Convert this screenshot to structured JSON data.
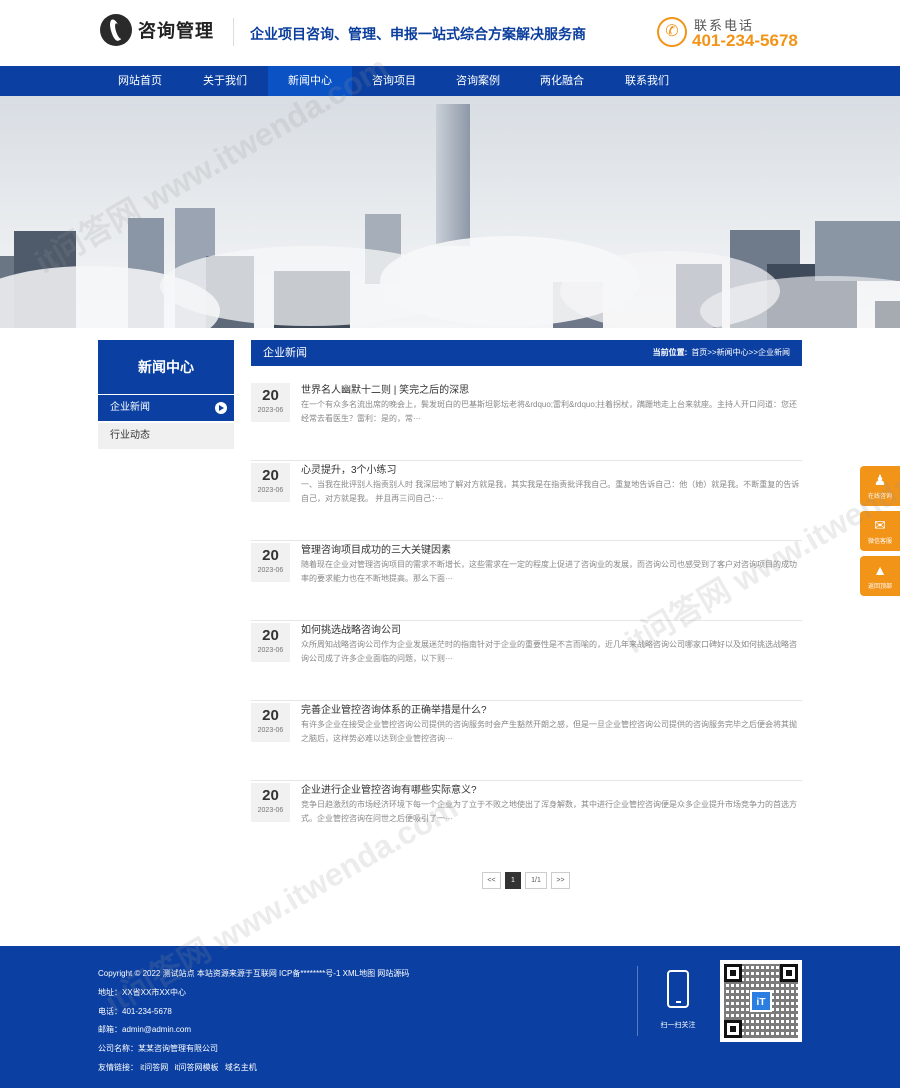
{
  "header": {
    "logo_text": "咨询管理",
    "slogan": "企业项目咨询、管理、申报一站式综合方案解决服务商",
    "phone_label": "联系电话",
    "phone_number": "401-234-5678"
  },
  "nav": {
    "items": [
      {
        "label": "网站首页"
      },
      {
        "label": "关于我们"
      },
      {
        "label": "新闻中心",
        "active": true
      },
      {
        "label": "咨询项目"
      },
      {
        "label": "咨询案例"
      },
      {
        "label": "两化融合"
      },
      {
        "label": "联系我们"
      }
    ]
  },
  "sidebar": {
    "title": "新闻中心",
    "items": [
      {
        "label": "企业新闻",
        "active": true
      },
      {
        "label": "行业动态"
      }
    ]
  },
  "content": {
    "title": "企业新闻",
    "location_label": "当前位置:",
    "breadcrumb": "首页>>新闻中心>>企业新闻",
    "news": [
      {
        "day": "20",
        "ym": "2023-06",
        "title": "世界名人幽默十二则 | 笑完之后的深思",
        "desc": "在一个有众多名流出席的晚会上，鬓发斑白的巴基斯坦影坛老将&rdquo;雷利&rdquo;拄着拐杖，蹒跚地走上台来就座。主持人开口问道：您还经常去看医生？雷利：是的，常···"
      },
      {
        "day": "20",
        "ym": "2023-06",
        "title": "心灵提升，3个小练习",
        "desc": "一、当我在批评别人指责别人时 我深层地了解对方就是我，其实我是在指责批评我自己。重复地告诉自己：他（她）就是我。不断重复的告诉自己，对方就是我。 并且再三问自己：···"
      },
      {
        "day": "20",
        "ym": "2023-06",
        "title": "管理咨询项目成功的三大关键因素",
        "desc": "随着现在企业对管理咨询项目的需求不断增长，这些需求在一定的程度上促进了咨询业的发展，而咨询公司也感受到了客户对咨询项目的成功率的要求能力也在不断地提高。那么下面···"
      },
      {
        "day": "20",
        "ym": "2023-06",
        "title": "如何挑选战略咨询公司",
        "desc": "众所周知战略咨询公司作为企业发展迷茫时的指南针对于企业的重要性是不言而喻的，近几年来战略咨询公司哪家口碑好以及如何挑选战略咨询公司成了许多企业面临的问题，以下则···"
      },
      {
        "day": "20",
        "ym": "2023-06",
        "title": "完善企业管控咨询体系的正确举措是什么?",
        "desc": "有许多企业在接受企业管控咨询公司提供的咨询服务时会产生豁然开朗之感，但是一旦企业管控咨询公司提供的咨询服务完毕之后便会将其抛之脑后，这样势必难以达到企业管控咨询···"
      },
      {
        "day": "20",
        "ym": "2023-06",
        "title": "企业进行企业管控咨询有哪些实际意义?",
        "desc": "竞争日趋激烈的市场经济环境下每一个企业为了立于不败之地使出了浑身解数，其中进行企业管控咨询便是众多企业提升市场竞争力的首选方式。企业管控咨询在问世之后便吸引了一···"
      }
    ]
  },
  "pagination": {
    "prev": "<<",
    "current": "1",
    "info": "1/1",
    "next": ">>"
  },
  "floats": [
    {
      "icon": "qq-icon",
      "glyph": "♟",
      "label": "在线咨询"
    },
    {
      "icon": "wechat-icon",
      "glyph": "✉",
      "label": "微信客服"
    },
    {
      "icon": "top-icon",
      "glyph": "▲",
      "label": "返回顶部"
    }
  ],
  "footer": {
    "copyright": "Copyright © 2022 测试站点 本站资源来源于互联网  ICP备********号-1 XML地图 网站源码",
    "address": "地址：XX省XX市XX中心",
    "phone": "电话：401-234-5678",
    "email": "邮箱：admin@admin.com",
    "company": "公司名称：某某咨询管理有限公司",
    "links_label": "友情链接：",
    "links": [
      "it问答网",
      "it问答网模板",
      "域名主机"
    ],
    "scan_label": "扫一扫关注",
    "qr_logo": "iT"
  },
  "watermark": "it问答网 www.itwenda.com",
  "colors": {
    "primary": "#0b40a2",
    "accent": "#f29418"
  }
}
